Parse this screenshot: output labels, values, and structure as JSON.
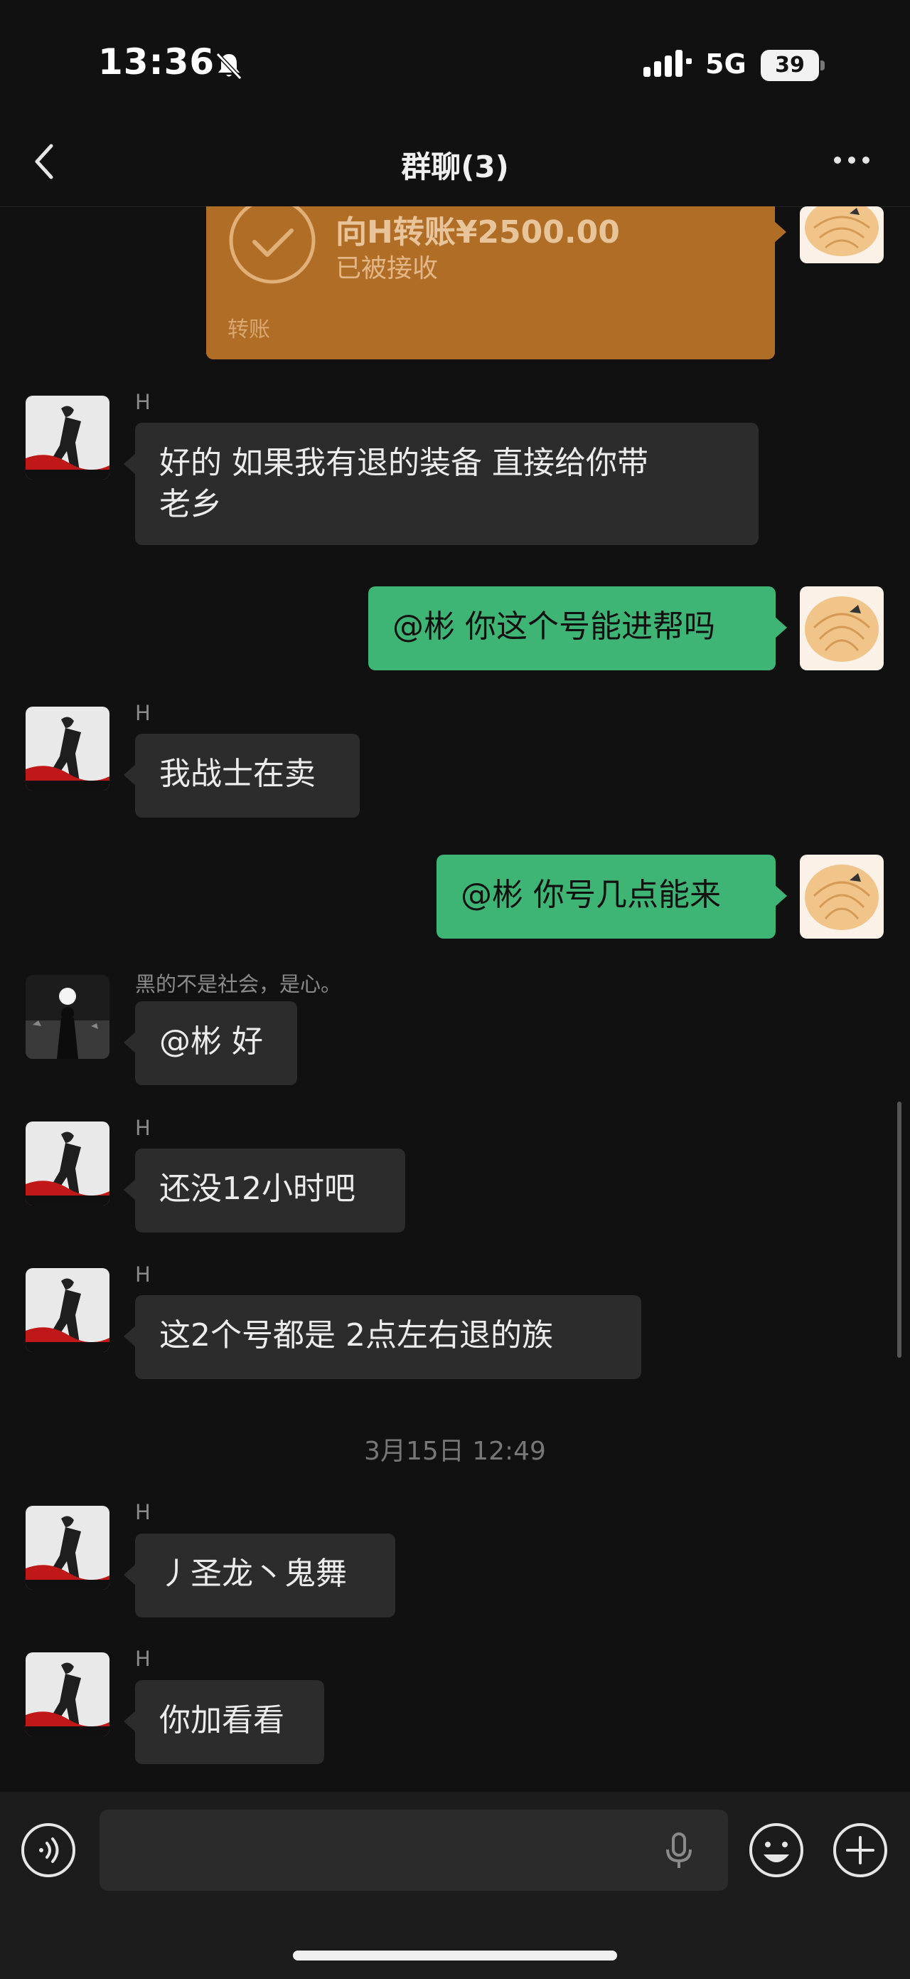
{
  "status_bar": {
    "time": "13:36",
    "network": "5G",
    "battery": "39"
  },
  "nav": {
    "title": "群聊(3)"
  },
  "transfer": {
    "amount": "向H转账¥2500.00",
    "status": "已被接收",
    "label": "转账"
  },
  "messages": [
    {
      "sender": "H",
      "text": "好的  如果我有退的装备 直接给你带\n老乡"
    },
    {
      "text": "@彬 你这个号能进帮吗"
    },
    {
      "sender": "H",
      "text": "我战士在卖"
    },
    {
      "text": "@彬 你号几点能来"
    },
    {
      "sender": "黑的不是社会，是心。",
      "text": "@彬 好"
    },
    {
      "sender": "H",
      "text": "还没12小时吧"
    },
    {
      "sender": "H",
      "text": "这2个号都是 2点左右退的族"
    },
    {
      "sender": "H",
      "text": "丿圣龙丶鬼舞"
    },
    {
      "sender": "H",
      "text": "你加看看"
    }
  ],
  "timestamp": "3月15日 12:49",
  "colors": {
    "bubble_out": "#3eb575",
    "bubble_in": "#2c2c2c",
    "transfer": "#b06d26"
  }
}
